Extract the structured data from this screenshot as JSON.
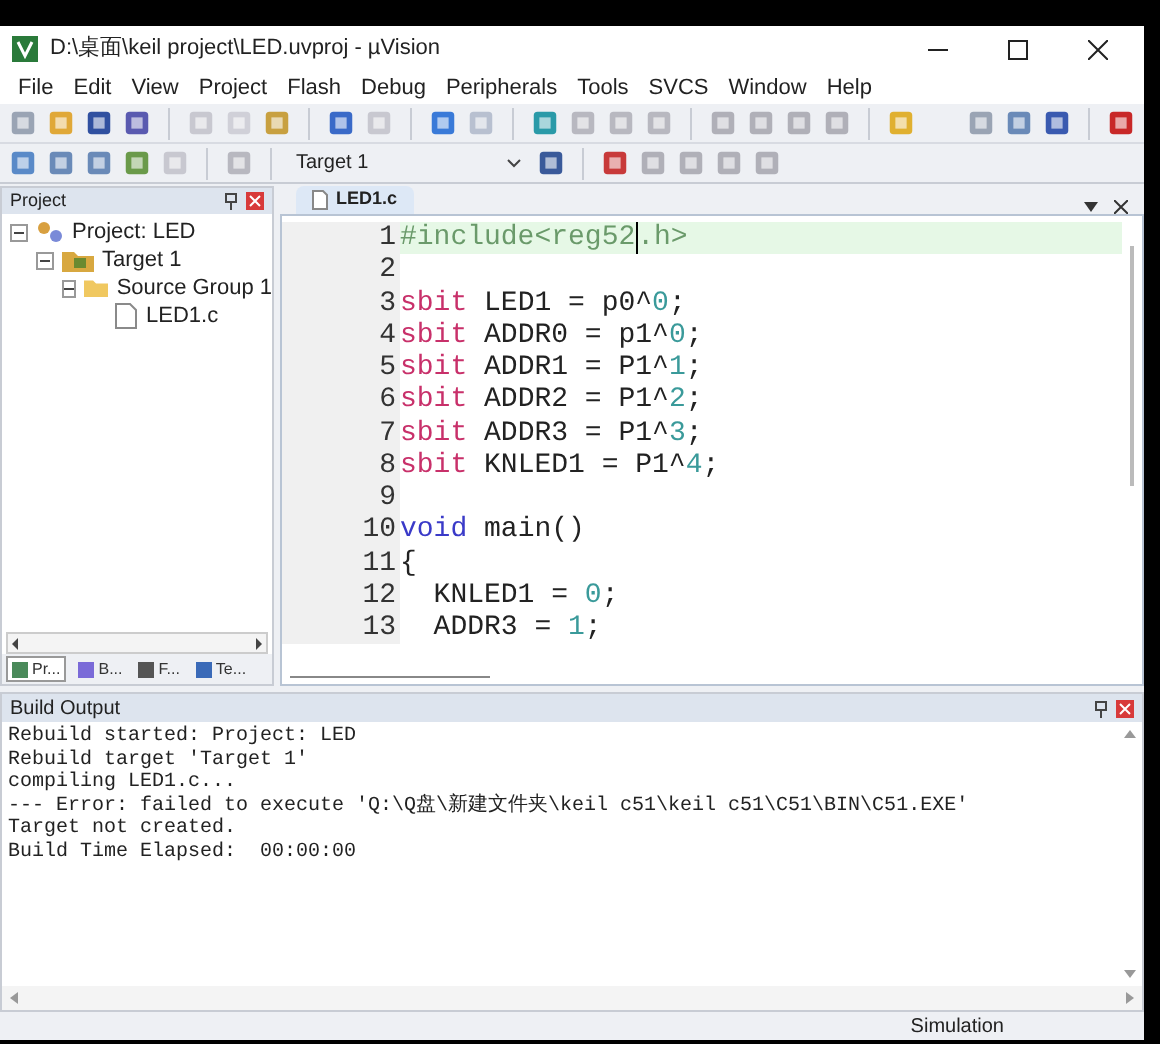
{
  "window": {
    "title": "D:\\桌面\\keil project\\LED.uvproj - µVision"
  },
  "menu": [
    "File",
    "Edit",
    "View",
    "Project",
    "Flash",
    "Debug",
    "Peripherals",
    "Tools",
    "SVCS",
    "Window",
    "Help"
  ],
  "target_select": {
    "value": "Target 1"
  },
  "project_panel": {
    "title": "Project",
    "tree": [
      {
        "label": "Project: LED",
        "kind": "project",
        "expanded": true,
        "children": [
          {
            "label": "Target 1",
            "kind": "target",
            "expanded": true,
            "children": [
              {
                "label": "Source Group 1",
                "kind": "group",
                "expanded": true,
                "children": [
                  {
                    "label": "LED1.c",
                    "kind": "file"
                  }
                ]
              }
            ]
          }
        ]
      }
    ],
    "tabs": [
      {
        "label": "Pr...",
        "selected": true
      },
      {
        "label": "B...",
        "selected": false
      },
      {
        "label": "F...",
        "selected": false
      },
      {
        "label": "Te...",
        "selected": false
      }
    ]
  },
  "editor": {
    "tabs": [
      {
        "label": "LED1.c",
        "selected": true
      }
    ],
    "lines": [
      {
        "number": "1",
        "current": true,
        "tokens": [
          {
            "kind": "directive",
            "text": "#include<reg52"
          },
          {
            "kind": "directive",
            "text": ".h>"
          }
        ]
      },
      {
        "number": "2",
        "current": false
      },
      {
        "number": "3",
        "current": false,
        "tokens": [
          {
            "kind": "keyword",
            "text": "sbit"
          },
          {
            "kind": "text",
            "text": " LED1 = p0^"
          },
          {
            "kind": "number",
            "text": "0"
          },
          {
            "kind": "text",
            "text": ";"
          }
        ]
      },
      {
        "number": "4",
        "current": false,
        "tokens": [
          {
            "kind": "keyword",
            "text": "sbit"
          },
          {
            "kind": "text",
            "text": " ADDR0 = p1^"
          },
          {
            "kind": "number",
            "text": "0"
          },
          {
            "kind": "text",
            "text": ";"
          }
        ]
      },
      {
        "number": "5",
        "current": false,
        "tokens": [
          {
            "kind": "keyword",
            "text": "sbit"
          },
          {
            "kind": "text",
            "text": " ADDR1 = P1^"
          },
          {
            "kind": "number",
            "text": "1"
          },
          {
            "kind": "text",
            "text": ";"
          }
        ]
      },
      {
        "number": "6",
        "current": false,
        "tokens": [
          {
            "kind": "keyword",
            "text": "sbit"
          },
          {
            "kind": "text",
            "text": " ADDR2 = P1^"
          },
          {
            "kind": "number",
            "text": "2"
          },
          {
            "kind": "text",
            "text": ";"
          }
        ]
      },
      {
        "number": "7",
        "current": false,
        "tokens": [
          {
            "kind": "keyword",
            "text": "sbit"
          },
          {
            "kind": "text",
            "text": " ADDR3 = P1^"
          },
          {
            "kind": "number",
            "text": "3"
          },
          {
            "kind": "text",
            "text": ";"
          }
        ]
      },
      {
        "number": "8",
        "current": false,
        "tokens": [
          {
            "kind": "keyword",
            "text": "sbit"
          },
          {
            "kind": "text",
            "text": " KNLED1 = P1^"
          },
          {
            "kind": "number",
            "text": "4"
          },
          {
            "kind": "text",
            "text": ";"
          }
        ]
      },
      {
        "number": "9",
        "current": false
      },
      {
        "number": "10",
        "current": false,
        "tokens": [
          {
            "kind": "type",
            "text": "void"
          },
          {
            "kind": "text",
            "text": " main()"
          }
        ]
      },
      {
        "number": "11",
        "current": false,
        "tokens": [
          {
            "kind": "text",
            "text": "{"
          }
        ]
      },
      {
        "number": "12",
        "current": false,
        "tokens": [
          {
            "kind": "text",
            "text": "  KNLED1 = "
          },
          {
            "kind": "number",
            "text": "0"
          },
          {
            "kind": "text",
            "text": ";"
          }
        ]
      },
      {
        "number": "13",
        "current": false,
        "tokens": [
          {
            "kind": "text",
            "text": "  ADDR3 = "
          },
          {
            "kind": "number",
            "text": "1"
          },
          {
            "kind": "text",
            "text": ";"
          }
        ]
      }
    ]
  },
  "build_output": {
    "title": "Build Output",
    "lines": [
      "Rebuild started: Project: LED",
      "Rebuild target 'Target 1'",
      "compiling LED1.c...",
      "--- Error: failed to execute 'Q:\\Q盘\\新建文件夹\\keil c51\\keil c51\\C51\\BIN\\C51.EXE'",
      "Target not created.",
      "Build Time Elapsed:  00:00:00"
    ]
  },
  "status_bar": {
    "mode": "Simulation"
  }
}
